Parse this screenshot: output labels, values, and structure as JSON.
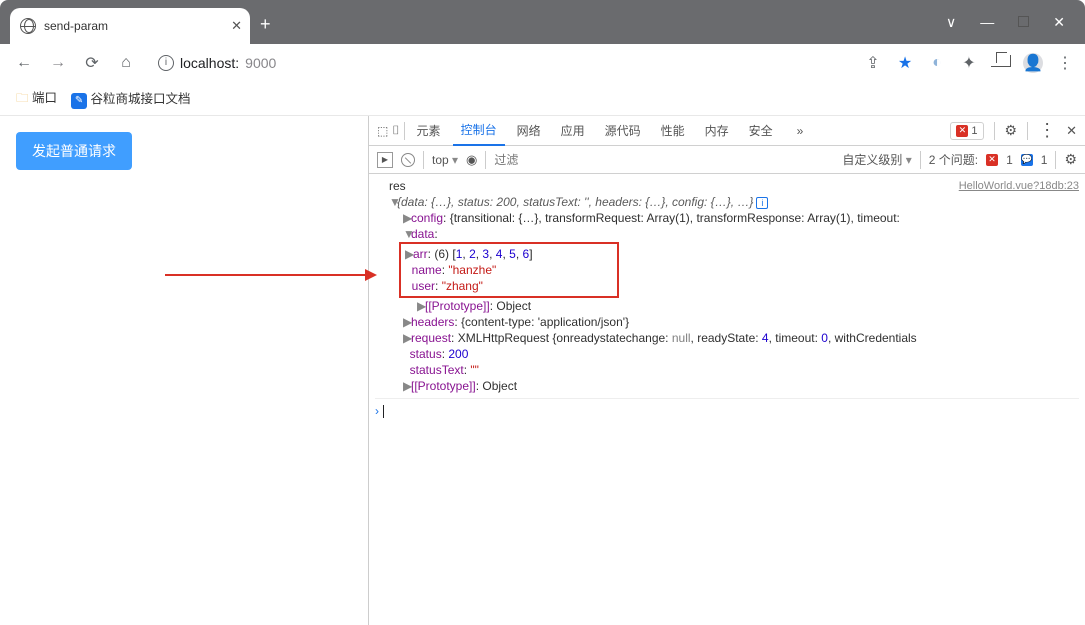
{
  "window": {
    "tab_title": "send-param",
    "minimize": "—",
    "maximize": "□",
    "close": "✕",
    "chevron": "∨"
  },
  "address": {
    "url_host": "localhost:",
    "url_port": "9000"
  },
  "bookmarks": {
    "item1": "端口",
    "item2": "谷粒商城接口文档"
  },
  "page": {
    "button_label": "发起普通请求"
  },
  "devtools": {
    "tabs": {
      "elements": "元素",
      "console": "控制台",
      "network": "网络",
      "application": "应用",
      "sources": "源代码",
      "performance": "性能",
      "memory": "内存",
      "security": "安全",
      "more": "»"
    },
    "error_count": "1",
    "filter": {
      "context": "top",
      "placeholder": "过滤",
      "level": "自定义级别",
      "issues_label": "2 个问题:",
      "err": "1",
      "msg": "1"
    },
    "log": {
      "res": "res",
      "source": "HelloWorld.vue?18db:23",
      "summary_prefix": "{data: {…}, status: ",
      "summary_status": "200",
      "summary_mid": ", statusText: '', headers: {…}, config: {…}, …}",
      "config_key": "config",
      "config_val": ": {transitional: {…}, transformRequest: Array(1), transformResponse: Array(1), timeout:",
      "data_key": "data",
      "arr_key": "arr",
      "arr_len": "(6)",
      "arr_vals": "[1, 2, 3, 4, 5, 6]",
      "name_key": "name",
      "name_val": "\"hanzhe\"",
      "user_key": "user",
      "user_val": "\"zhang\"",
      "proto_key": "[[Prototype]]",
      "proto_val": ": Object",
      "headers_key": "headers",
      "headers_val": "{content-type: 'application/json'}",
      "request_key": "request",
      "request_val_pre": "XMLHttpRequest {onreadystatechange: ",
      "request_null": "null",
      "request_mid1": ", readyState: ",
      "request_ready": "4",
      "request_mid2": ", timeout: ",
      "request_timeout": "0",
      "request_tail": ", withCredentials",
      "status_key": "status",
      "status_val": "200",
      "statusText_key": "statusText",
      "statusText_val": "\"\""
    }
  }
}
